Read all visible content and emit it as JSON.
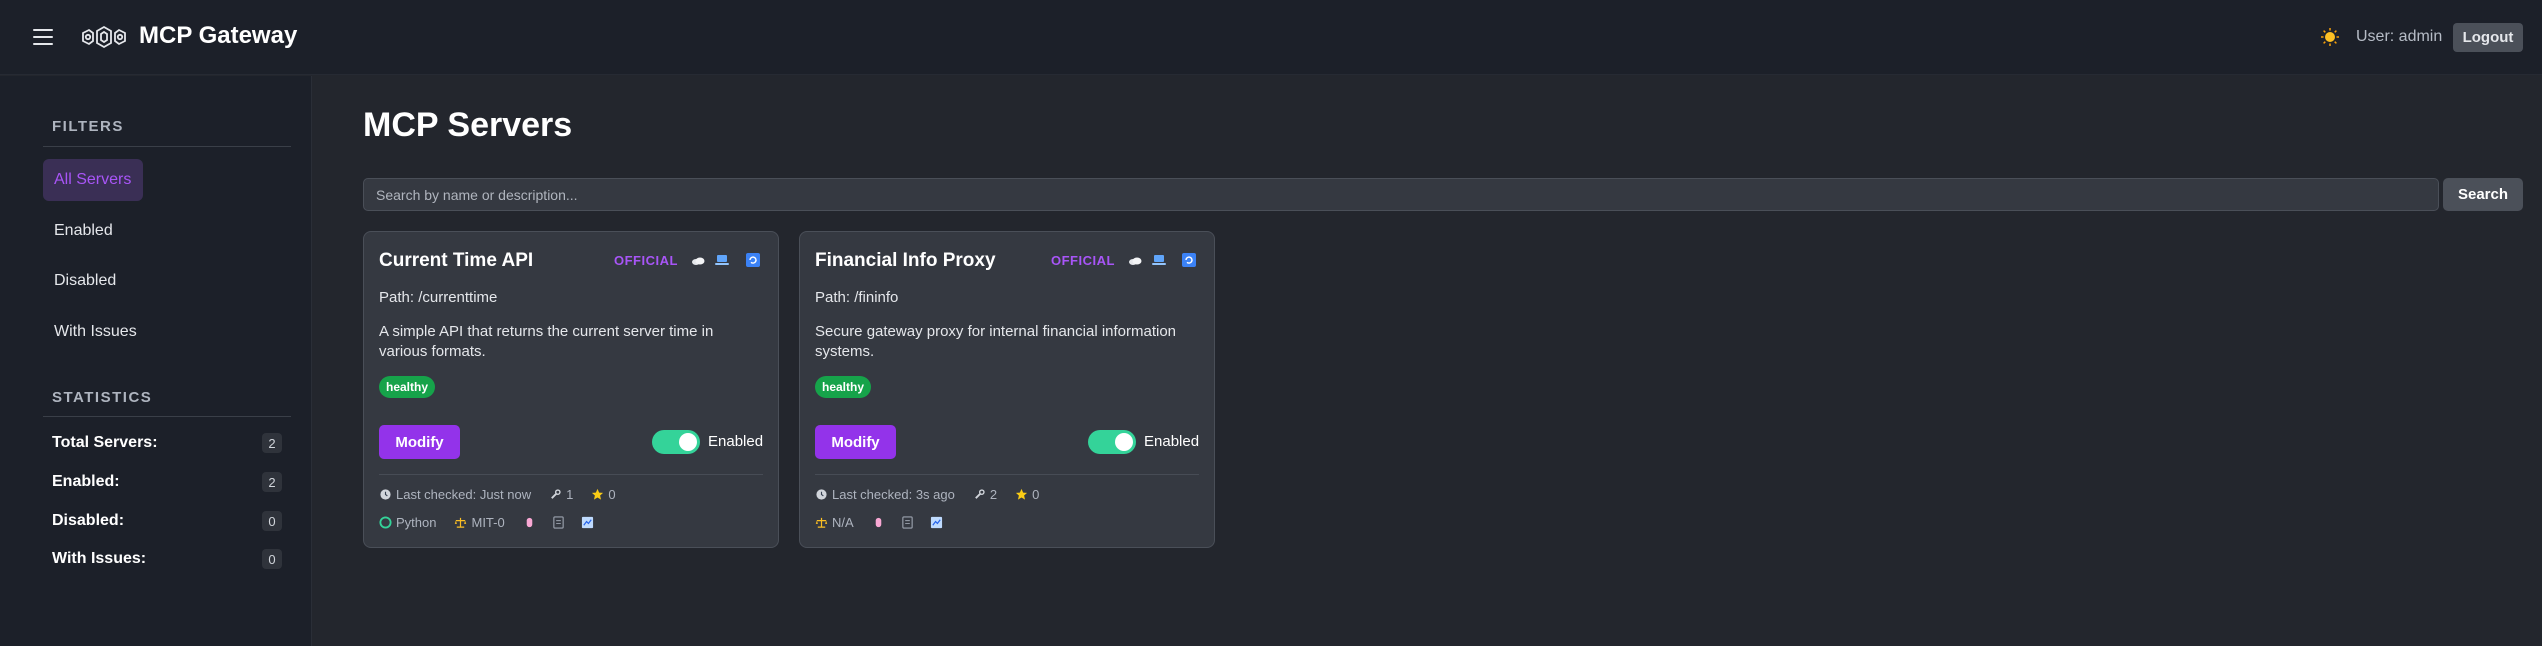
{
  "app": {
    "title": "MCP Gateway",
    "user_label": "User: admin",
    "logout_label": "Logout"
  },
  "sidebar": {
    "filters_title": "FILTERS",
    "filters": [
      {
        "label": "All Servers",
        "active": true
      },
      {
        "label": "Enabled",
        "active": false
      },
      {
        "label": "Disabled",
        "active": false
      },
      {
        "label": "With Issues",
        "active": false
      }
    ],
    "stats_title": "STATISTICS",
    "stats": [
      {
        "label": "Total Servers:",
        "count": "2"
      },
      {
        "label": "Enabled:",
        "count": "2"
      },
      {
        "label": "Disabled:",
        "count": "0"
      },
      {
        "label": "With Issues:",
        "count": "0"
      }
    ]
  },
  "main": {
    "title": "MCP Servers",
    "search_placeholder": "Search by name or description...",
    "search_label": "Search"
  },
  "cards": [
    {
      "title": "Current Time API",
      "badge": "OFFICIAL",
      "path": "Path: /currenttime",
      "description": "A simple API that returns the current server time in various formats.",
      "health": "healthy",
      "modify_label": "Modify",
      "enabled": true,
      "toggle_label": "Enabled",
      "last_checked": "Last checked: Just now",
      "tools_count": "1",
      "stars_count": "0",
      "language": "Python",
      "license": "MIT-0"
    },
    {
      "title": "Financial Info Proxy",
      "badge": "OFFICIAL",
      "path": "Path: /fininfo",
      "description": "Secure gateway proxy for internal financial information systems.",
      "health": "healthy",
      "modify_label": "Modify",
      "enabled": true,
      "toggle_label": "Enabled",
      "last_checked": "Last checked: 3s ago",
      "tools_count": "2",
      "stars_count": "0",
      "license": "N/A"
    }
  ],
  "colors": {
    "accent": "#9333ea",
    "healthy": "#16a34a",
    "toggle_on": "#34d399"
  }
}
